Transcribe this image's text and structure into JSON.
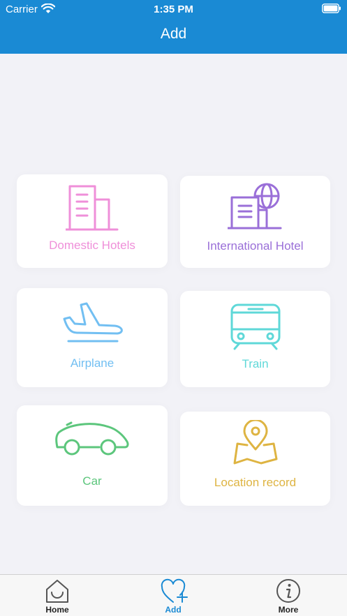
{
  "status_bar": {
    "carrier": "Carrier",
    "time": "1:35 PM"
  },
  "nav": {
    "title": "Add"
  },
  "cards": [
    {
      "key": "domestic",
      "label": "Domestic Hotels",
      "icon": "building-icon",
      "color": "#ef8fd9"
    },
    {
      "key": "intl",
      "label": "International Hotel",
      "icon": "globe-building-icon",
      "color": "#9a6fd8"
    },
    {
      "key": "airplane",
      "label": "Airplane",
      "icon": "airplane-icon",
      "color": "#72bff2"
    },
    {
      "key": "train",
      "label": "Train",
      "icon": "train-icon",
      "color": "#5fd8d8"
    },
    {
      "key": "car",
      "label": "Car",
      "icon": "car-icon",
      "color": "#5cc67c"
    },
    {
      "key": "location",
      "label": "Location record",
      "icon": "map-pin-icon",
      "color": "#deb442"
    }
  ],
  "tabs": [
    {
      "key": "home",
      "label": "Home",
      "icon": "home-icon",
      "active": false
    },
    {
      "key": "add",
      "label": "Add",
      "icon": "heart-plus-icon",
      "active": true
    },
    {
      "key": "more",
      "label": "More",
      "icon": "info-icon",
      "active": false
    }
  ],
  "colors": {
    "primary": "#1a8ad4",
    "background": "#f2f2f7"
  }
}
